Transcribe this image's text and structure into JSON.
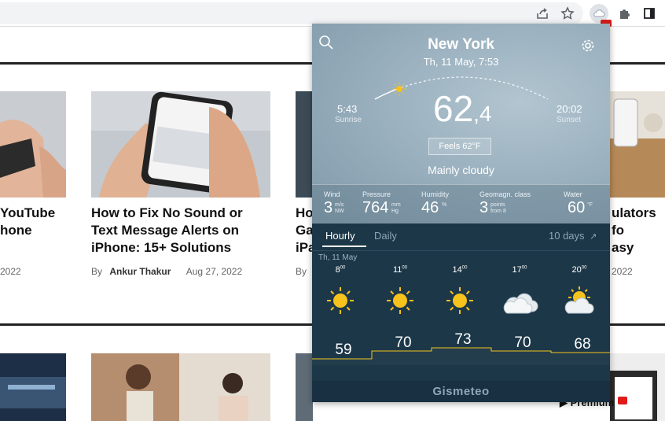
{
  "browser": {
    "icons": [
      "share-icon",
      "star-icon",
      "gismeteo-extension-icon",
      "puzzle-icon",
      "sidepanel-icon"
    ]
  },
  "articles": [
    {
      "title_lines": [
        "YouTube",
        "hone"
      ],
      "date": "2022"
    },
    {
      "title_lines": [
        "How to Fix No Sound or",
        "Text Message Alerts on",
        "iPhone: 15+ Solutions"
      ],
      "by": "By",
      "author": "Ankur Thakur",
      "date": "Aug 27, 2022"
    },
    {
      "title_lines": [
        "Ho",
        "Ga",
        "iPa"
      ],
      "by": "By"
    },
    {
      "title_lines": [
        "ulators fo",
        "asy"
      ],
      "date": "2022"
    }
  ],
  "weather": {
    "city": "New York",
    "datetime": "Th, 11 May, 7:53",
    "sunrise_time": "5:43",
    "sunrise_label": "Sunrise",
    "sunset_time": "20:02",
    "sunset_label": "Sunset",
    "temp_main": "62",
    "temp_frac": ",4",
    "feels": "Feels  62°F",
    "condition": "Mainly cloudy",
    "stats": {
      "wind": {
        "label": "Wind",
        "value": "3",
        "unit_top": "m/s",
        "unit_bottom": "NW"
      },
      "pressure": {
        "label": "Pressure",
        "value": "764",
        "unit_top": "mm",
        "unit_bottom": "Hg"
      },
      "humidity": {
        "label": "Humidity",
        "value": "46",
        "unit_top": "%"
      },
      "geomag": {
        "label": "Geomagn. class",
        "value": "3",
        "unit_top": "points",
        "unit_bottom": "from 8"
      },
      "water": {
        "label": "Water",
        "value": "60",
        "unit_top": "°F"
      }
    },
    "tabs": {
      "hourly": "Hourly",
      "daily": "Daily",
      "ten_days": "10 days"
    },
    "day_label": "Th, 11 May",
    "hours": [
      {
        "hour": "8",
        "sup": "00",
        "icon": "sun-icon",
        "temp": 59
      },
      {
        "hour": "11",
        "sup": "00",
        "icon": "sun-icon",
        "temp": 70
      },
      {
        "hour": "14",
        "sup": "00",
        "icon": "sun-icon",
        "temp": 73
      },
      {
        "hour": "17",
        "sup": "00",
        "icon": "cloud-icon",
        "temp": 70
      },
      {
        "hour": "20",
        "sup": "00",
        "icon": "sun-cloud-icon",
        "temp": 68
      }
    ],
    "brand": "Gismeteo",
    "colors": {
      "accent": "#f5c518",
      "dark_panel": "#1c3748",
      "sun": "#f6c21c"
    }
  }
}
